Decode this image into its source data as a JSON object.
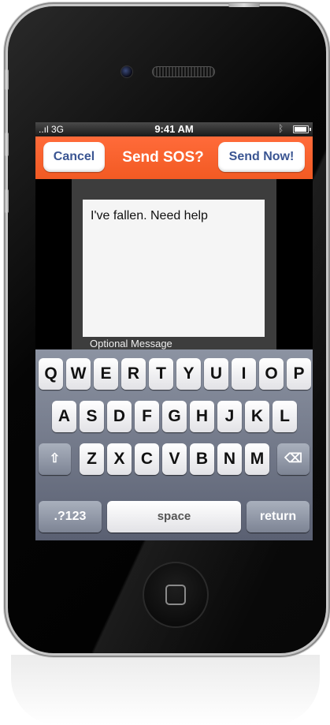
{
  "status_bar": {
    "signal": "..ıl 3G",
    "time": "9:41 AM",
    "bluetooth": "bluetooth-icon",
    "battery": "battery-icon"
  },
  "navbar": {
    "cancel_label": "Cancel",
    "title": "Send SOS?",
    "send_label": "Send Now!"
  },
  "message": {
    "value": "I've fallen. Need help",
    "label": "Optional Message"
  },
  "keyboard": {
    "row1": [
      "Q",
      "W",
      "E",
      "R",
      "T",
      "Y",
      "U",
      "I",
      "O",
      "P"
    ],
    "row2": [
      "A",
      "S",
      "D",
      "F",
      "G",
      "H",
      "J",
      "K",
      "L"
    ],
    "row3": [
      "Z",
      "X",
      "C",
      "V",
      "B",
      "N",
      "M"
    ],
    "shift_icon": "⇧",
    "delete_icon": "⌫",
    "numbers_label": ".?123",
    "space_label": "space",
    "return_label": "return"
  },
  "colors": {
    "navbar": "#f25a23",
    "button_text": "#3a5592"
  }
}
